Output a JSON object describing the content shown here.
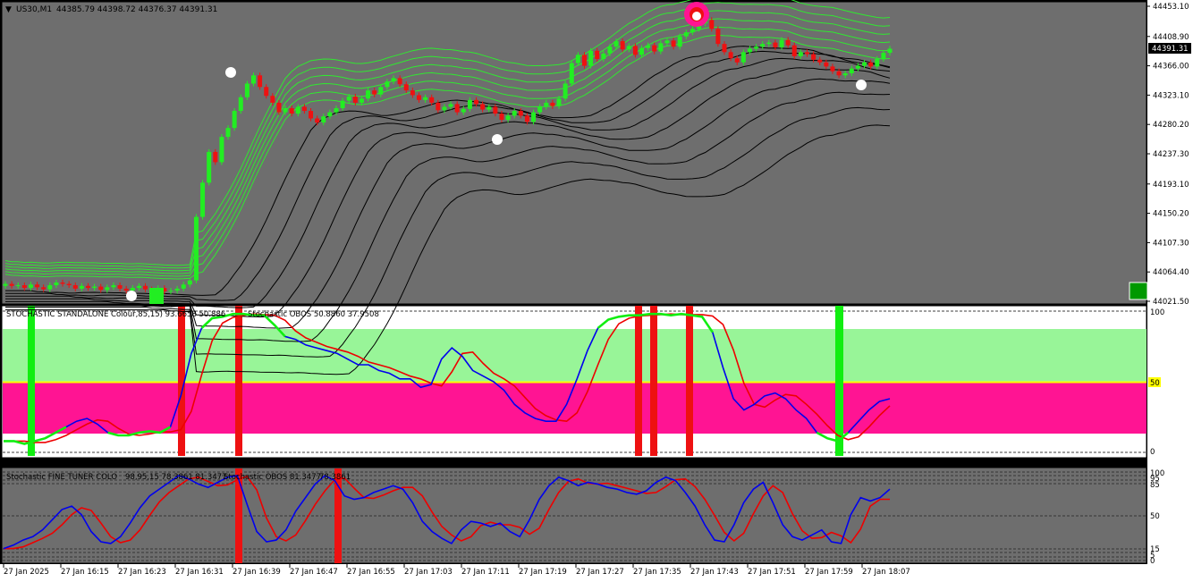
{
  "colors": {
    "background": "#6e6e6e",
    "bull": "#22ee22",
    "bear": "#ee1111",
    "envelope_green": "#30e830",
    "envelope_black": "#000000",
    "signal_magenta": "#ff1493",
    "stoch_blue": "#0000ee",
    "stoch_red": "#ee0000",
    "stoch_green": "#11ee11",
    "zone_light_green": "#98f598",
    "zone_pink": "#ff1493",
    "level_yellow": "#ffff00"
  },
  "header": {
    "symbol_label": "US30,M1",
    "ohlc_label": "44385.79 44398.72 44376.37 44391.31"
  },
  "price_axis": {
    "ticks": [
      "44453.10",
      "44408.90",
      "44366.00",
      "44323.10",
      "44280.20",
      "44237.30",
      "44193.10",
      "44150.20",
      "44107.30",
      "44064.40",
      "44021.50"
    ],
    "current_price_label": "44391.31"
  },
  "time_axis": {
    "labels": [
      "27 Jan 2025",
      "27 Jan 16:15",
      "27 Jan 16:23",
      "27 Jan 16:31",
      "27 Jan 16:39",
      "27 Jan 16:47",
      "27 Jan 16:55",
      "27 Jan 17:03",
      "27 Jan 17:11",
      "27 Jan 17:19",
      "27 Jan 17:27",
      "27 Jan 17:35",
      "27 Jan 17:43",
      "27 Jan 17:51",
      "27 Jan 17:59",
      "27 Jan 18:07"
    ]
  },
  "panel1": {
    "label": "STOCHASTIC STANDALONE Colour,85,15) 93.6658 50.886",
    "label2": "Stochastic OBOS 50.8860 37.9508",
    "scale_labels": [
      "100",
      "50",
      "0"
    ],
    "level_50_label": "50"
  },
  "panel2": {
    "label": "Stochastic FINE TUNER COLO",
    "label_mid": "98,95,15 78.3861 81.3477",
    "label2": "Stochastic OBOS 81.3477",
    "label3": "78.3861",
    "scale_labels": [
      "100",
      "95",
      "85",
      "50",
      "15",
      "5",
      "0"
    ]
  },
  "chart_data": {
    "type": "candlestick",
    "symbol": "US30",
    "timeframe": "M1",
    "time_labels": [
      "27 Jan 2025",
      "27 Jan 16:15",
      "27 Jan 16:23",
      "27 Jan 16:31",
      "27 Jan 16:39",
      "27 Jan 16:47",
      "27 Jan 16:55",
      "27 Jan 17:03",
      "27 Jan 17:11",
      "27 Jan 17:19",
      "27 Jan 17:27",
      "27 Jan 17:35",
      "27 Jan 17:43",
      "27 Jan 17:51",
      "27 Jan 17:59",
      "27 Jan 18:07"
    ],
    "ylim": [
      44000,
      44460
    ],
    "close": [
      44047,
      44044,
      44045,
      44041,
      44046,
      44042,
      44039,
      44045,
      44049,
      44047,
      44045,
      44040,
      44044,
      44041,
      44043,
      44038,
      44042,
      44045,
      44040,
      44037,
      44041,
      44044,
      44039,
      44038,
      44041,
      44036,
      44037,
      44040,
      44046,
      44052,
      44145,
      44195,
      44240,
      44225,
      44262,
      44275,
      44300,
      44320,
      44340,
      44352,
      44335,
      44322,
      44312,
      44298,
      44304,
      44296,
      44306,
      44300,
      44289,
      44283,
      44292,
      44298,
      44304,
      44315,
      44321,
      44312,
      44318,
      44330,
      44324,
      44335,
      44343,
      44348,
      44339,
      44330,
      44323,
      44316,
      44320,
      44312,
      44301,
      44306,
      44310,
      44298,
      44303,
      44316,
      44310,
      44302,
      44306,
      44296,
      44287,
      44293,
      44300,
      44293,
      44284,
      44298,
      44306,
      44312,
      44307,
      44318,
      44340,
      44370,
      44382,
      44366,
      44388,
      44376,
      44384,
      44394,
      44402,
      44390,
      44395,
      44382,
      44392,
      44396,
      44387,
      44399,
      44403,
      44394,
      44409,
      44415,
      44420,
      44428,
      44433,
      44420,
      44398,
      44386,
      44377,
      44371,
      44386,
      44391,
      44394,
      44398,
      44400,
      44393,
      44404,
      44396,
      44380,
      44386,
      44383,
      44375,
      44371,
      44365,
      44358,
      44352,
      44355,
      44362,
      44366,
      44371,
      44365,
      44376,
      44385,
      44391
    ],
    "series": [
      {
        "name": "Stochastic OBOS",
        "panel": 1,
        "values": [
          8,
          8,
          6,
          8,
          10,
          14,
          18,
          22,
          24,
          20,
          14,
          12,
          12,
          14,
          15,
          14,
          18,
          40,
          70,
          88,
          95,
          96,
          98,
          98,
          97,
          97,
          90,
          82,
          80,
          76,
          74,
          72,
          70,
          66,
          62,
          62,
          58,
          56,
          52,
          52,
          46,
          48,
          66,
          74,
          68,
          58,
          54,
          50,
          44,
          34,
          28,
          24,
          22,
          22,
          34,
          52,
          72,
          88,
          94,
          96,
          97,
          97,
          98,
          98,
          97,
          98,
          97,
          96,
          85,
          60,
          38,
          30,
          34,
          40,
          42,
          38,
          30,
          24,
          14,
          10,
          8,
          14,
          22,
          30,
          36,
          38
        ]
      },
      {
        "name": "Stochastic OBOS",
        "panel": 2,
        "values": [
          12,
          16,
          22,
          26,
          34,
          46,
          58,
          62,
          52,
          32,
          20,
          18,
          26,
          42,
          60,
          74,
          82,
          90,
          98,
          94,
          88,
          84,
          90,
          96,
          98,
          64,
          32,
          20,
          22,
          34,
          56,
          72,
          88,
          98,
          92,
          74,
          70,
          72,
          78,
          82,
          86,
          82,
          66,
          44,
          32,
          24,
          18,
          34,
          44,
          42,
          38,
          42,
          32,
          26,
          46,
          70,
          86,
          96,
          92,
          86,
          90,
          88,
          84,
          82,
          78,
          76,
          80,
          90,
          96,
          92,
          78,
          62,
          40,
          22,
          20,
          40,
          66,
          82,
          90,
          66,
          40,
          26,
          22,
          28,
          34,
          20,
          18,
          52,
          72,
          68,
          72,
          82
        ]
      }
    ]
  }
}
